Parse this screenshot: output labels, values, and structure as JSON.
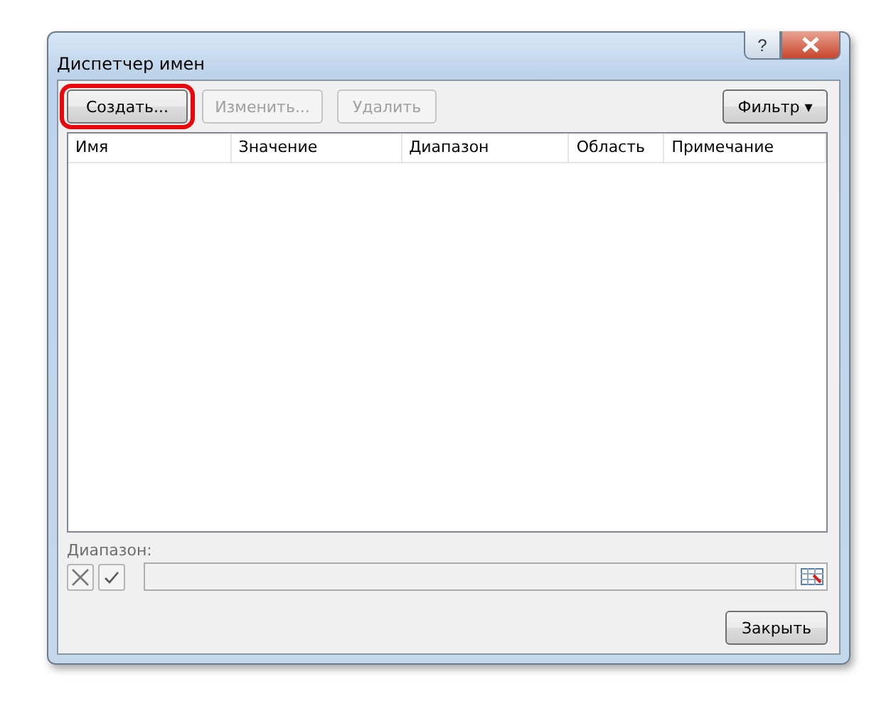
{
  "window": {
    "title": "Диспетчер имен",
    "help_button": "?"
  },
  "toolbar": {
    "buttons": [
      {
        "label": "Создать...",
        "disabled": false,
        "highlighted": true
      },
      {
        "label": "Изменить...",
        "disabled": true,
        "highlighted": false
      },
      {
        "label": "Удалить",
        "disabled": true,
        "highlighted": false
      }
    ],
    "filter_button": {
      "label": "Фильтр",
      "caret": "▾"
    }
  },
  "table": {
    "columns": [
      "Имя",
      "Значение",
      "Диапазон",
      "Область",
      "Примечание"
    ]
  },
  "range": {
    "label": "Диапазон:"
  },
  "close_button": {
    "label": "Закрыть"
  }
}
